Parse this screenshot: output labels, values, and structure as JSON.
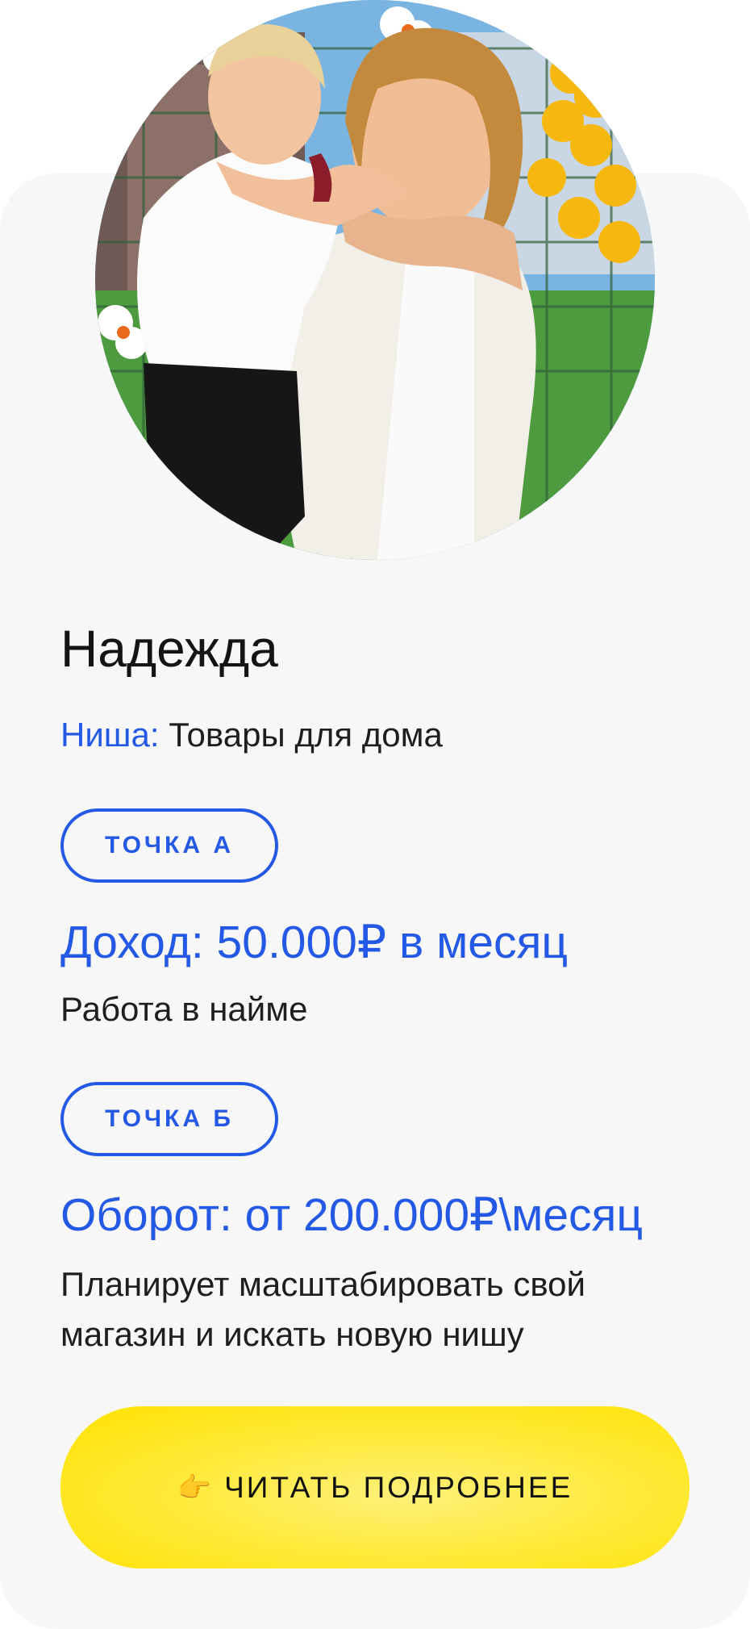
{
  "profile": {
    "name": "Надежда",
    "niche_label": "Ниша:",
    "niche_value": "Товары для дома",
    "avatar_icon": "person-photo"
  },
  "point_a": {
    "badge": "ТОЧКА А",
    "headline": "Доход: 50.000₽ в месяц",
    "description": "Работа в найме"
  },
  "point_b": {
    "badge": "ТОЧКА Б",
    "headline": "Оборот: от 200.000₽\\месяц",
    "description": "Планирует масштабировать свой магазин и искать новую нишу"
  },
  "cta": {
    "icon": "👉",
    "label": "ЧИТАТЬ ПОДРОБНЕЕ"
  },
  "colors": {
    "accent": "#2459e6",
    "cta": "#ffe200",
    "card": "#f7f7f7",
    "text": "#141414"
  }
}
